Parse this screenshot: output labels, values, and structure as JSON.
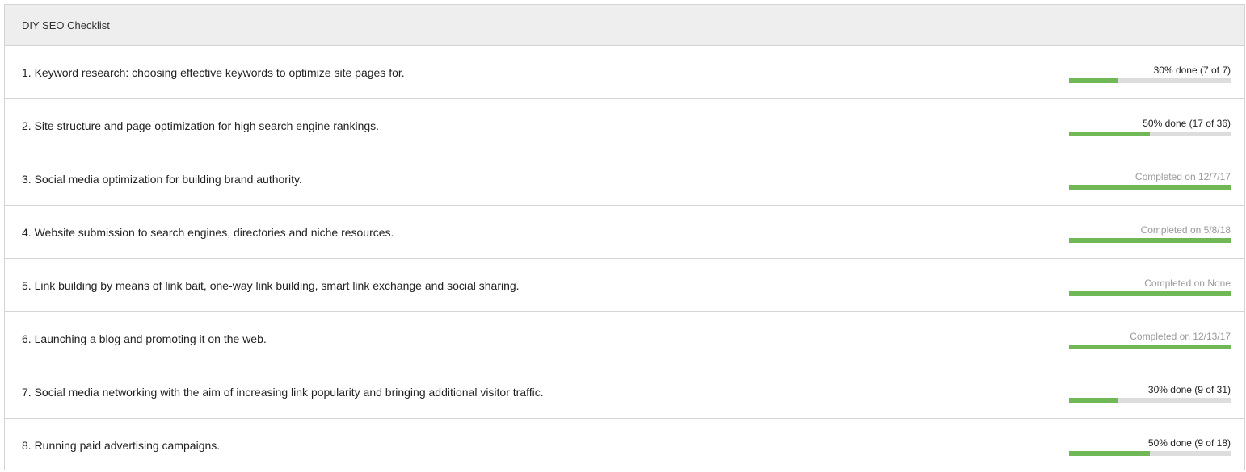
{
  "header": {
    "title": "DIY SEO Checklist"
  },
  "rows": [
    {
      "title": "1.  Keyword research: choosing effective keywords to optimize site pages for.",
      "status": "30% done (7 of 7)",
      "completed": false,
      "progress": 0.3
    },
    {
      "title": "2.  Site structure and page optimization for high search engine rankings.",
      "status": "50% done (17 of 36)",
      "completed": false,
      "progress": 0.5
    },
    {
      "title": "3.  Social media optimization for building brand authority.",
      "status": "Completed on 12/7/17",
      "completed": true,
      "progress": 1.0
    },
    {
      "title": "4.  Website submission to search engines, directories and niche resources.",
      "status": "Completed on 5/8/18",
      "completed": true,
      "progress": 1.0
    },
    {
      "title": "5.  Link building by means of link bait, one-way link building, smart link exchange and social sharing.",
      "status": "Completed on None",
      "completed": true,
      "progress": 1.0
    },
    {
      "title": "6.  Launching a blog and promoting it on the web.",
      "status": "Completed on 12/13/17",
      "completed": true,
      "progress": 1.0
    },
    {
      "title": "7.  Social media networking with the aim of increasing link popularity and bringing additional visitor traffic.",
      "status": "30% done (9 of 31)",
      "completed": false,
      "progress": 0.3
    },
    {
      "title": "8.  Running paid advertising campaigns.",
      "status": "50% done (9 of 18)",
      "completed": false,
      "progress": 0.5
    }
  ],
  "colors": {
    "progress_fill": "#70b856",
    "progress_track": "#dddddd",
    "header_bg": "#eeeeee",
    "completed_text": "#9a9a9a"
  }
}
